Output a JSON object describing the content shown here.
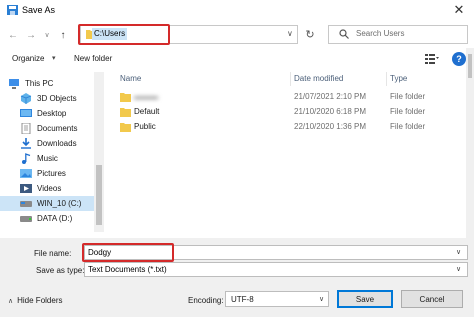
{
  "window": {
    "title": "Save As",
    "close_glyph": "✕"
  },
  "address_bar": {
    "path": "C:\\Users",
    "dropdown_glyph": "∨",
    "refresh_glyph": "↻"
  },
  "search": {
    "placeholder": "Search Users"
  },
  "toolbar": {
    "organize_label": "Organize",
    "organize_caret": "▾",
    "new_folder_label": "New folder",
    "help_glyph": "?"
  },
  "nav_pane": {
    "items": [
      {
        "label": "This PC",
        "icon": "computer-icon"
      },
      {
        "label": "3D Objects",
        "icon": "cube-icon"
      },
      {
        "label": "Desktop",
        "icon": "desktop-icon"
      },
      {
        "label": "Documents",
        "icon": "document-icon"
      },
      {
        "label": "Downloads",
        "icon": "download-icon"
      },
      {
        "label": "Music",
        "icon": "music-icon"
      },
      {
        "label": "Pictures",
        "icon": "picture-icon"
      },
      {
        "label": "Videos",
        "icon": "video-icon"
      },
      {
        "label": "WIN_10 (C:)",
        "icon": "drive-icon",
        "selected": true
      },
      {
        "label": "DATA (D:)",
        "icon": "drive-icon"
      }
    ]
  },
  "file_list": {
    "columns": [
      "Name",
      "Date modified",
      "Type"
    ],
    "rows": [
      {
        "name": "",
        "date": "21/07/2021 2:10 PM",
        "type": "File folder",
        "redacted": true
      },
      {
        "name": "Default",
        "date": "21/10/2020 6:18 PM",
        "type": "File folder"
      },
      {
        "name": "Public",
        "date": "22/10/2020 1:36 PM",
        "type": "File folder"
      }
    ]
  },
  "save_form": {
    "file_name_label": "File name:",
    "file_name_value": "Dodgy",
    "save_as_type_label": "Save as type:",
    "save_as_type_value": "Text Documents (*.txt)",
    "caret": "∨"
  },
  "footer": {
    "hide_folders_label": "Hide Folders",
    "encoding_label": "Encoding:",
    "encoding_value": "UTF-8",
    "save_label": "Save",
    "cancel_label": "Cancel"
  },
  "colors": {
    "highlight_box": "#d42a2a",
    "selection": "#cce4f7",
    "folder": "#f2c94c",
    "accent": "#0078d7"
  }
}
